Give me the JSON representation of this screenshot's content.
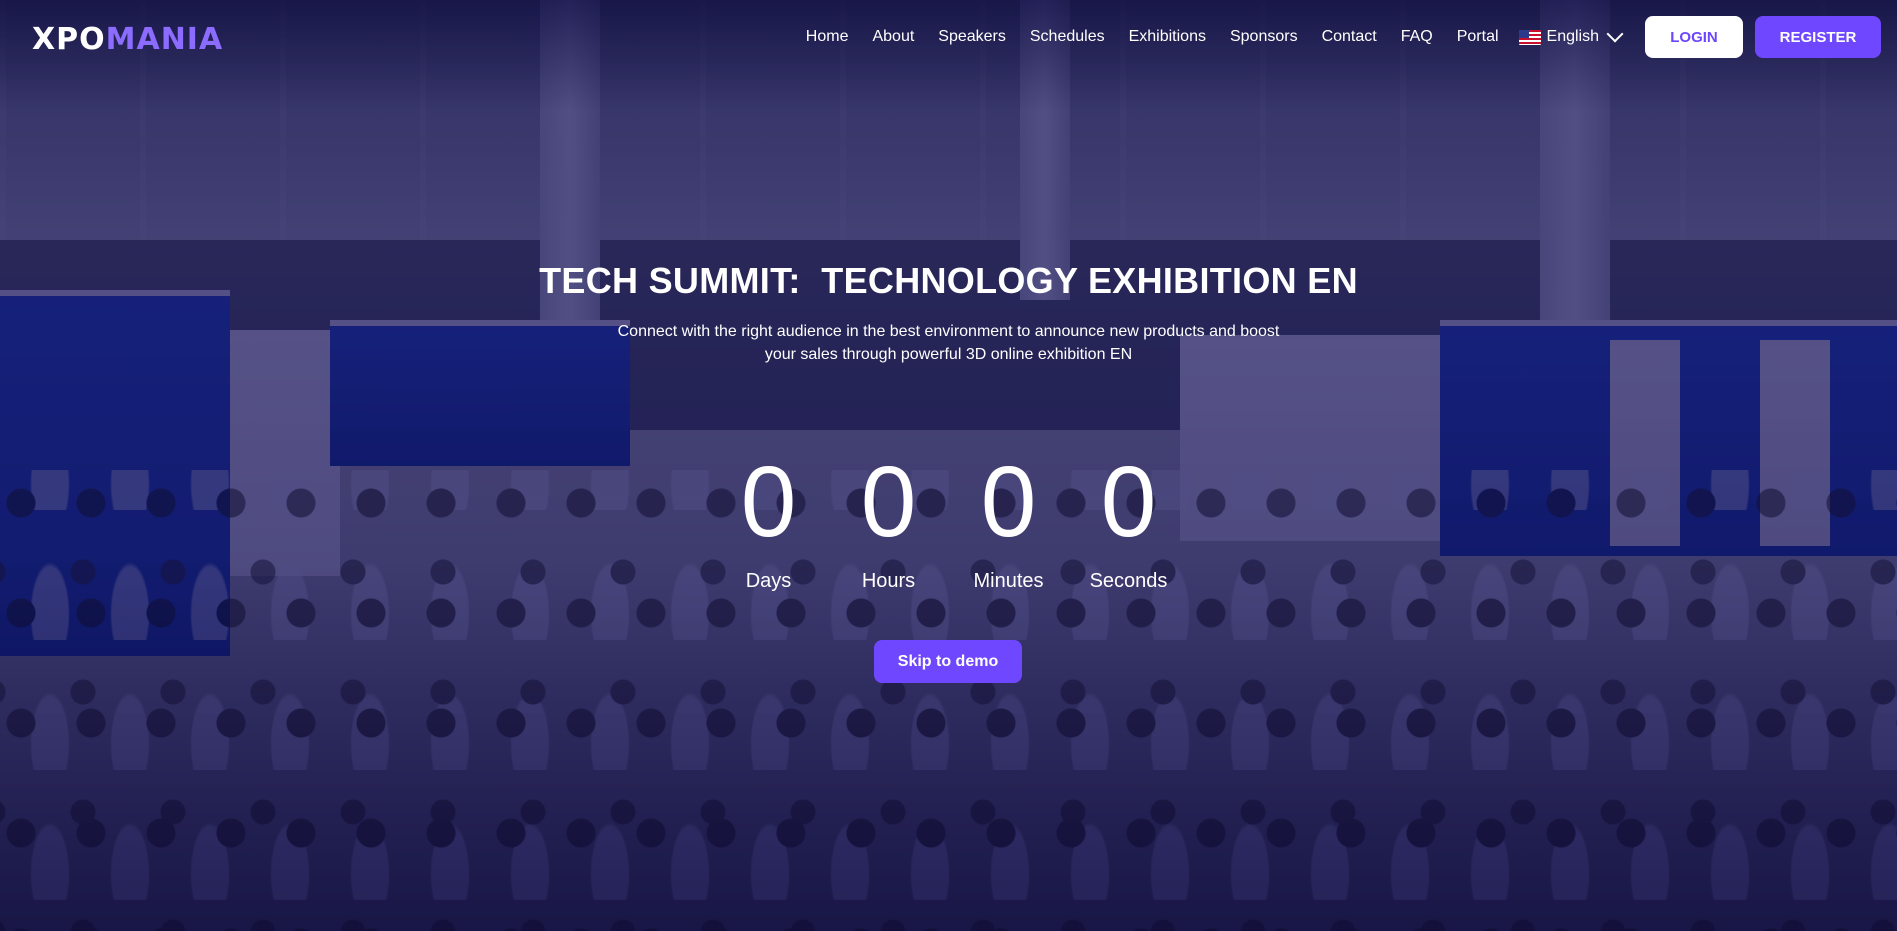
{
  "brand": {
    "logo_part1": "XPO",
    "logo_part2": "MANIA",
    "accent": "#6e47ff"
  },
  "nav": {
    "items": [
      {
        "label": "Home"
      },
      {
        "label": "About"
      },
      {
        "label": "Speakers"
      },
      {
        "label": "Schedules"
      },
      {
        "label": "Exhibitions"
      },
      {
        "label": "Sponsors"
      },
      {
        "label": "Contact"
      },
      {
        "label": "FAQ"
      },
      {
        "label": "Portal"
      }
    ],
    "language": {
      "label": "English",
      "flag_icon": "us-flag-icon",
      "chevron_icon": "chevron-down-icon"
    },
    "login_label": "LOGIN",
    "register_label": "REGISTER"
  },
  "hero": {
    "title": "TECH SUMMIT:  TECHNOLOGY EXHIBITION EN",
    "subtitle": "Connect with the right audience in the best environment to announce new products and boost your sales through powerful 3D online exhibition EN",
    "countdown": [
      {
        "value": "0",
        "label": "Days"
      },
      {
        "value": "0",
        "label": "Hours"
      },
      {
        "value": "0",
        "label": "Minutes"
      },
      {
        "value": "0",
        "label": "Seconds"
      }
    ],
    "cta_label": "Skip to demo"
  }
}
